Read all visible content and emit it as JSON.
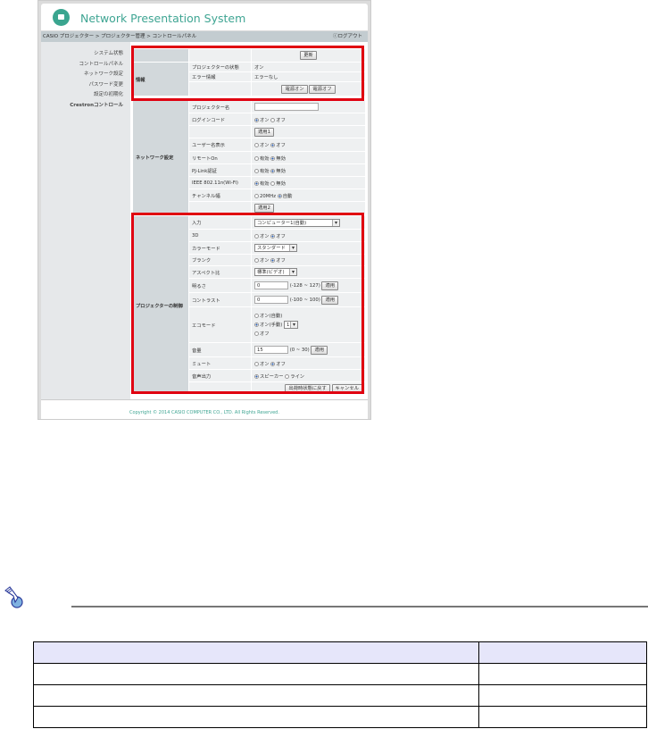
{
  "app": {
    "title": "Network Presentation System",
    "breadcrumb": "CASIO プロジェクター > プロジェクター管理 > コントロールパネル",
    "logout": "ⓘログアウト",
    "copyright": "Copyright © 2014 CASIO COMPUTER CO., LTD. All Rights Reserved."
  },
  "sidebar": [
    "システム状態",
    "コントロールパネル",
    "ネットワーク設定",
    "パスワード変更",
    "設定の初期化",
    "Crestronコントロール"
  ],
  "info": {
    "section": "情報",
    "refresh": "更新",
    "status_label": "プロジェクターの状態",
    "status_value": "オン",
    "error_label": "エラー情報",
    "error_value": "エラーなし",
    "power_on": "電源オン",
    "power_off": "電源オフ"
  },
  "network": {
    "section": "ネットワーク設定",
    "projector_name": "プロジェクター名",
    "login_code": "ログインコード",
    "on": "オン",
    "off": "オフ",
    "apply1": "適用1",
    "username_display": "ユーザー名表示",
    "remote_on": "リモートOn",
    "pjlink": "PJ-Link認証",
    "enabled": "有効",
    "disabled": "無効",
    "ieee": "IEEE 802.11n(Wi-Fi)",
    "channel_width": "チャンネル幅",
    "mhz20": "20MHz",
    "auto": "自動",
    "apply2": "適用2"
  },
  "control": {
    "section": "プロジェクターの制御",
    "input": "入力",
    "input_value": "コンピューター1(自動)",
    "three_d": "3D",
    "color_mode": "カラーモード",
    "color_value": "スタンダード",
    "blank": "ブランク",
    "aspect": "アスペクト比",
    "aspect_value": "標準(ビデオ)",
    "brightness": "明るさ",
    "brightness_value": "0",
    "brightness_range": "(-128 ~ 127)",
    "contrast": "コントラスト",
    "contrast_value": "0",
    "contrast_range": "(-100 ~ 100)",
    "apply": "適用",
    "eco": "エコモード",
    "eco_auto": "オン(自動)",
    "eco_manual": "オン(手動)",
    "eco_level": "1",
    "volume": "音量",
    "volume_value": "15",
    "volume_range": "(0 ~ 30)",
    "mute": "ミュート",
    "audio_out": "音声出力",
    "speaker": "スピーカー",
    "line": "ライン",
    "reset": "出荷時状態に戻す",
    "cancel": "キャンセル",
    "on": "オン",
    "off": "オフ"
  }
}
